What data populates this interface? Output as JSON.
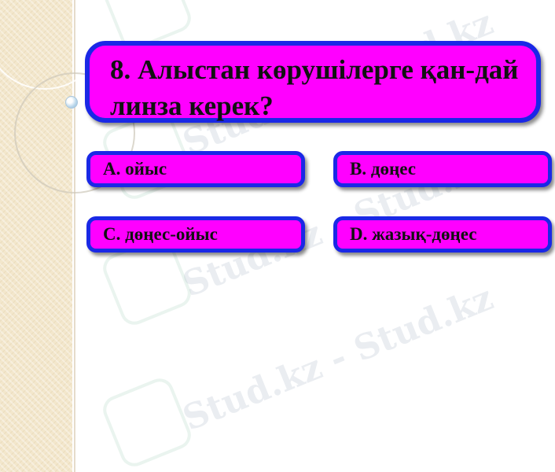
{
  "slide": {
    "question": "8. Алыстан көрушілерге қан-дай линза керек?",
    "answers": [
      {
        "label": "A. ойыс"
      },
      {
        "label": "B. дөңес"
      },
      {
        "label": "C. дөңес-ойыс"
      },
      {
        "label": "D. жазық-дөңес"
      }
    ]
  },
  "watermark": {
    "text": "Stud.kz - Stud.kz"
  },
  "colors": {
    "box_fill": "#ff00ff",
    "box_border": "#1a28e6",
    "side_strip": "#f3e7cc"
  }
}
